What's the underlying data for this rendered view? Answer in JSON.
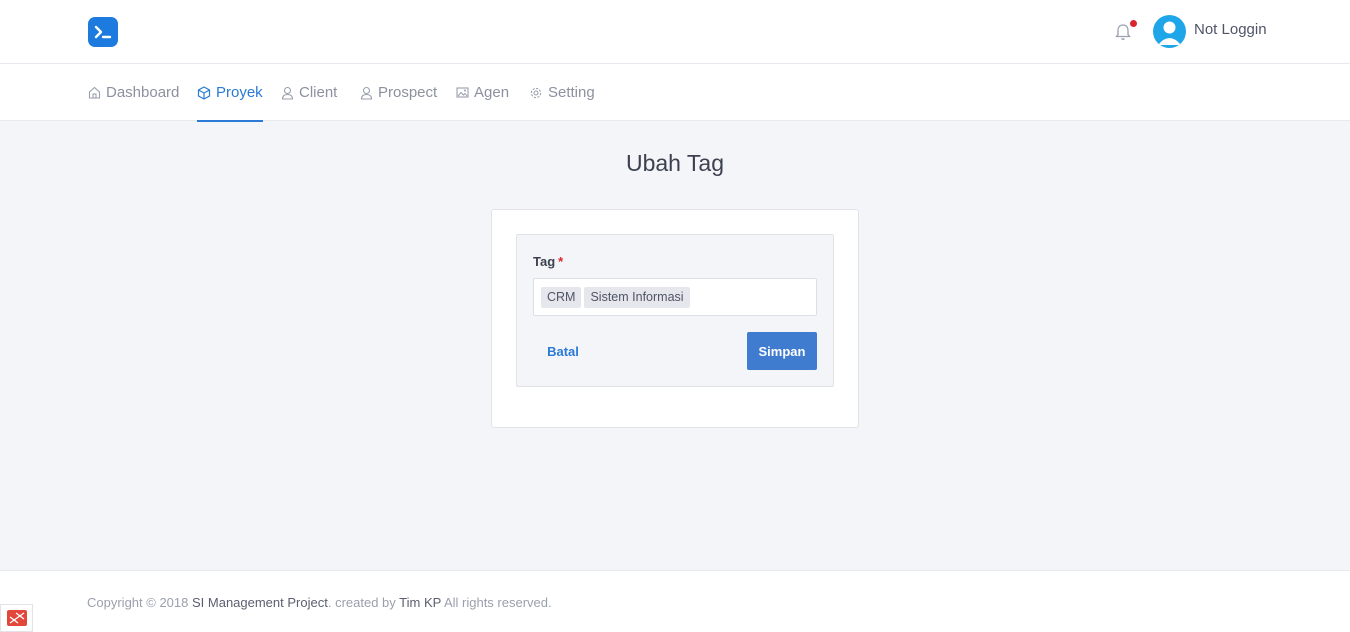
{
  "header": {
    "user_name": "Not Loggin",
    "notification_icon": "bell-icon",
    "logo_icon": "terminal-logo-icon",
    "brand_color": "#1d7be0"
  },
  "nav": {
    "items": [
      {
        "label": "Dashboard",
        "icon": "home-icon",
        "active": false
      },
      {
        "label": "Proyek",
        "icon": "box-icon",
        "active": true
      },
      {
        "label": "Client",
        "icon": "user-icon",
        "active": false
      },
      {
        "label": "Prospect",
        "icon": "user-icon",
        "active": false
      },
      {
        "label": "Agen",
        "icon": "image-icon",
        "active": false
      },
      {
        "label": "Setting",
        "icon": "gear-icon",
        "active": false
      }
    ]
  },
  "page": {
    "title": "Ubah Tag"
  },
  "form": {
    "tag_label": "Tag",
    "required_mark": "*",
    "tags": [
      "CRM",
      "Sistem Informasi"
    ],
    "cancel_label": "Batal",
    "save_label": "Simpan"
  },
  "footer": {
    "prefix": "Copyright © 2018 ",
    "project": "SI Management Project",
    "middle": ". created by ",
    "team": "Tim KP",
    "suffix": " All rights reserved."
  }
}
